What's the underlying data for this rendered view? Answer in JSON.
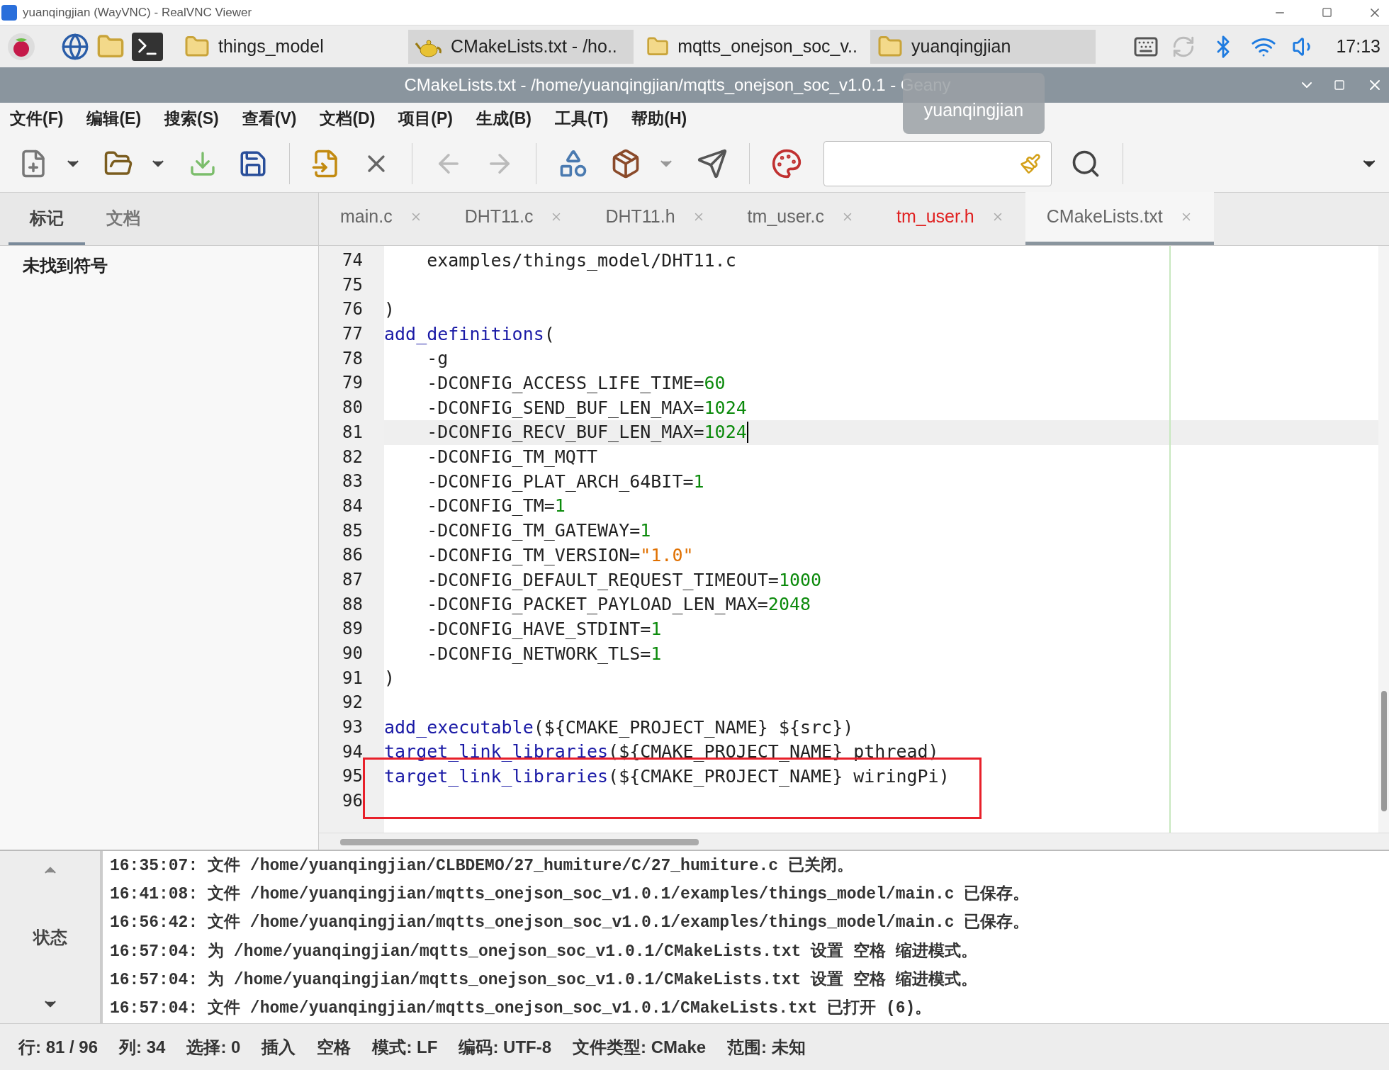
{
  "vnc_window": {
    "title": "yuanqingjian (WayVNC) - RealVNC Viewer"
  },
  "taskbar": {
    "windows": [
      {
        "label": "things_model",
        "kind": "folder",
        "selected": false
      },
      {
        "label": "CMakeLists.txt - /ho..",
        "kind": "editor",
        "selected": true
      },
      {
        "label": "mqtts_onejson_soc_v..",
        "kind": "folder",
        "selected": false
      },
      {
        "label": "yuanqingjian",
        "kind": "folder",
        "selected": true
      }
    ],
    "clock": "17:13"
  },
  "window": {
    "title": "CMakeLists.txt - /home/yuanqingjian/mqtts_onejson_soc_v1.0.1 - Geany",
    "tooltip": "yuanqingjian"
  },
  "menu": [
    "文件(F)",
    "编辑(E)",
    "搜索(S)",
    "查看(V)",
    "文档(D)",
    "项目(P)",
    "生成(B)",
    "工具(T)",
    "帮助(H)"
  ],
  "sidebar": {
    "tabs": [
      {
        "label": "标记",
        "selected": true
      },
      {
        "label": "文档",
        "selected": false
      }
    ],
    "message": "未找到符号"
  },
  "tabs": [
    {
      "label": "main.c",
      "selected": false,
      "modified": false
    },
    {
      "label": "DHT11.c",
      "selected": false,
      "modified": false
    },
    {
      "label": "DHT11.h",
      "selected": false,
      "modified": false
    },
    {
      "label": "tm_user.c",
      "selected": false,
      "modified": false
    },
    {
      "label": "tm_user.h",
      "selected": false,
      "modified": true
    },
    {
      "label": "CMakeLists.txt",
      "selected": true,
      "modified": false
    }
  ],
  "editor": {
    "lines": [
      {
        "number": "74",
        "current": false,
        "boxed": false,
        "segments": [
          {
            "kind": "plain",
            "text": "    examples/things_model/DHT11.c"
          }
        ]
      },
      {
        "number": "75",
        "current": false,
        "boxed": false
      },
      {
        "number": "76",
        "current": false,
        "boxed": false,
        "segments": [
          {
            "kind": "plain",
            "text": ")"
          }
        ]
      },
      {
        "number": "77",
        "current": false,
        "boxed": false,
        "segments": [
          {
            "kind": "keyword",
            "text": "add_definitions"
          },
          {
            "kind": "plain",
            "text": "("
          }
        ]
      },
      {
        "number": "78",
        "current": false,
        "boxed": false,
        "segments": [
          {
            "kind": "plain",
            "text": "    -g"
          }
        ]
      },
      {
        "number": "79",
        "current": false,
        "boxed": false,
        "segments": [
          {
            "kind": "plain",
            "text": "    -DCONFIG_ACCESS_LIFE_TIME="
          },
          {
            "kind": "number",
            "text": "60"
          }
        ]
      },
      {
        "number": "80",
        "current": false,
        "boxed": false,
        "segments": [
          {
            "kind": "plain",
            "text": "    -DCONFIG_SEND_BUF_LEN_MAX="
          },
          {
            "kind": "number",
            "text": "1024"
          }
        ]
      },
      {
        "number": "81",
        "current": true,
        "boxed": false,
        "segments": [
          {
            "kind": "plain",
            "text": "    -DCONFIG_RECV_BUF_LEN_MAX="
          },
          {
            "kind": "number",
            "text": "1024"
          }
        ]
      },
      {
        "number": "82",
        "current": false,
        "boxed": false,
        "segments": [
          {
            "kind": "plain",
            "text": "    -DCONFIG_TM_MQTT"
          }
        ]
      },
      {
        "number": "83",
        "current": false,
        "boxed": false,
        "segments": [
          {
            "kind": "plain",
            "text": "    -DCONFIG_PLAT_ARCH_64BIT="
          },
          {
            "kind": "number",
            "text": "1"
          }
        ]
      },
      {
        "number": "84",
        "current": false,
        "boxed": false,
        "segments": [
          {
            "kind": "plain",
            "text": "    -DCONFIG_TM="
          },
          {
            "kind": "number",
            "text": "1"
          }
        ]
      },
      {
        "number": "85",
        "current": false,
        "boxed": false,
        "segments": [
          {
            "kind": "plain",
            "text": "    -DCONFIG_TM_GATEWAY="
          },
          {
            "kind": "number",
            "text": "1"
          }
        ]
      },
      {
        "number": "86",
        "current": false,
        "boxed": false,
        "segments": [
          {
            "kind": "plain",
            "text": "    -DCONFIG_TM_VERSION="
          },
          {
            "kind": "string",
            "text": "\"1.0\""
          }
        ]
      },
      {
        "number": "87",
        "current": false,
        "boxed": false,
        "segments": [
          {
            "kind": "plain",
            "text": "    -DCONFIG_DEFAULT_REQUEST_TIMEOUT="
          },
          {
            "kind": "number",
            "text": "1000"
          }
        ]
      },
      {
        "number": "88",
        "current": false,
        "boxed": false,
        "segments": [
          {
            "kind": "plain",
            "text": "    -DCONFIG_PACKET_PAYLOAD_LEN_MAX="
          },
          {
            "kind": "number",
            "text": "2048"
          }
        ]
      },
      {
        "number": "89",
        "current": false,
        "boxed": false,
        "segments": [
          {
            "kind": "plain",
            "text": "    -DCONFIG_HAVE_STDINT="
          },
          {
            "kind": "number",
            "text": "1"
          }
        ]
      },
      {
        "number": "90",
        "current": false,
        "boxed": false,
        "segments": [
          {
            "kind": "plain",
            "text": "    -DCONFIG_NETWORK_TLS="
          },
          {
            "kind": "number",
            "text": "1"
          }
        ]
      },
      {
        "number": "91",
        "current": false,
        "boxed": false,
        "segments": [
          {
            "kind": "plain",
            "text": ")"
          }
        ]
      },
      {
        "number": "92",
        "current": false,
        "boxed": false
      },
      {
        "number": "93",
        "current": false,
        "boxed": false,
        "segments": [
          {
            "kind": "keyword",
            "text": "add_executable"
          },
          {
            "kind": "plain",
            "text": "(${CMAKE_PROJECT_NAME} ${src})"
          }
        ]
      },
      {
        "number": "94",
        "current": false,
        "boxed": false,
        "segments": [
          {
            "kind": "keyword",
            "text": "target_link_libraries"
          },
          {
            "kind": "plain",
            "text": "(${CMAKE_PROJECT_NAME} pthread)"
          }
        ]
      },
      {
        "number": "95",
        "current": false,
        "boxed": true,
        "segments": [
          {
            "kind": "keyword",
            "text": "target_link_libraries"
          },
          {
            "kind": "plain",
            "text": "(${CMAKE_PROJECT_NAME} wiringPi)"
          }
        ]
      },
      {
        "number": "96",
        "current": false,
        "boxed": true
      }
    ]
  },
  "messages": {
    "tab": "状态",
    "lines": [
      "16:35:07: 文件 /home/yuanqingjian/CLBDEMO/27_humiture/C/27_humiture.c 已关闭。",
      "16:41:08: 文件 /home/yuanqingjian/mqtts_onejson_soc_v1.0.1/examples/things_model/main.c 已保存。",
      "16:56:42: 文件 /home/yuanqingjian/mqtts_onejson_soc_v1.0.1/examples/things_model/main.c 已保存。",
      "16:57:04: 为 /home/yuanqingjian/mqtts_onejson_soc_v1.0.1/CMakeLists.txt 设置 空格 缩进模式。",
      "16:57:04: 为 /home/yuanqingjian/mqtts_onejson_soc_v1.0.1/CMakeLists.txt 设置 空格 缩进模式。",
      "16:57:04: 文件 /home/yuanqingjian/mqtts_onejson_soc_v1.0.1/CMakeLists.txt 已打开 (6)。"
    ]
  },
  "status_bar": [
    "行: 81 / 96",
    "列: 34",
    "选择: 0",
    "插入",
    "空格",
    "模式: LF",
    "编码: UTF-8",
    "文件类型: CMake",
    "范围: 未知"
  ]
}
